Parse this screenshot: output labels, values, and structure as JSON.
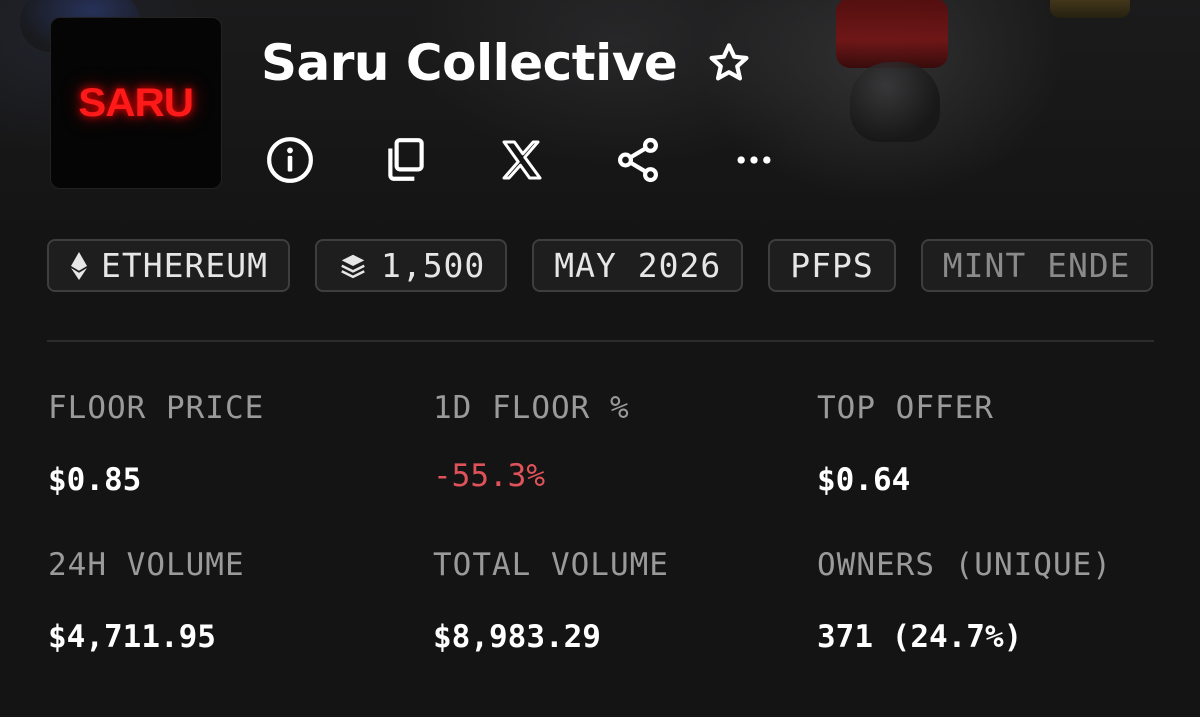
{
  "collection": {
    "name": "Saru Collective",
    "logo_text": "SARU"
  },
  "icons": {
    "favorite": "star-outline-icon",
    "info": "info-icon",
    "copy": "copy-icon",
    "x": "x-logo-icon",
    "share": "share-icon",
    "more": "more-horizontal-icon",
    "chain": "ethereum-icon",
    "supply": "layers-icon"
  },
  "chips": [
    {
      "label": "ETHEREUM"
    },
    {
      "label": "1,500"
    },
    {
      "label": "MAY 2026"
    },
    {
      "label": "PFPS"
    },
    {
      "label": "MINT ENDE"
    }
  ],
  "stats": {
    "floor_price": {
      "label": "FLOOR PRICE",
      "value": "$0.85"
    },
    "floor_change_1d": {
      "label": "1D FLOOR %",
      "value": "-55.3%"
    },
    "top_offer": {
      "label": "TOP OFFER",
      "value": "$0.64"
    },
    "volume_24h": {
      "label": "24H VOLUME",
      "value": "$4,711.95"
    },
    "total_volume": {
      "label": "TOTAL VOLUME",
      "value": "$8,983.29"
    },
    "owners": {
      "label": "OWNERS (UNIQUE)",
      "value": "371 (24.7%)"
    }
  },
  "colors": {
    "background": "#141414",
    "negative": "#e0525a",
    "logo_red": "#ff1a1a",
    "chip_border": "#3e3e3e",
    "label_gray": "#9a9a9a"
  }
}
